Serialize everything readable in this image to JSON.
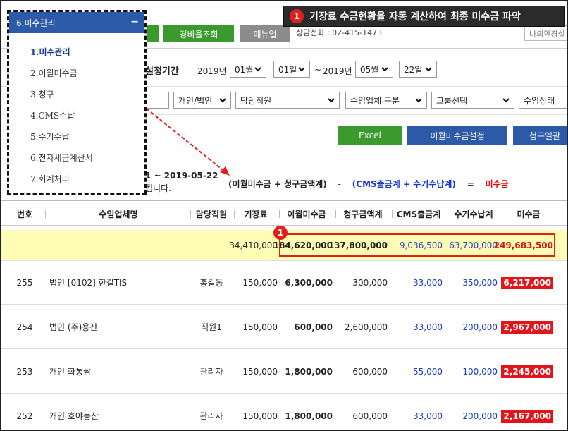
{
  "callout": {
    "badge": "1",
    "text": "기장료 수금현황을 자동 계산하여 최종 미수금 파악"
  },
  "topbar": {
    "btn_green2": "경비율조회",
    "btn_manual": "매뉴얼",
    "phone": "상담전화 : 02-415-1473",
    "right_box": "나의환경설"
  },
  "period": {
    "label": "설정기간",
    "start_year": "2019년",
    "start_month": "01월",
    "start_day": "01일",
    "tilde": "~",
    "end_year": "2019년",
    "end_month": "05월",
    "end_day": "22일"
  },
  "filters": {
    "type": "개인/법인",
    "manager": "담당직원",
    "company_type": "수임업체 구분",
    "group": "그룹선택",
    "status": "수임상태"
  },
  "actions": {
    "excel": "Excel",
    "carryover_setting": "이월미수금설정",
    "bill_batch": "청구일괄"
  },
  "summary": {
    "range": "1 ~ 2019-05-22",
    "range_sub": "됩니다.",
    "formula_a": "(이월미수금 + 청구금액계)",
    "op_minus": "-",
    "formula_b": "(CMS출금계 + 수기수납계)",
    "op_equal": "=",
    "formula_result": "미수금"
  },
  "menu": {
    "header": "6.미수관리",
    "collapse": "−",
    "items": [
      "1.미수관리",
      "2.이월미수금",
      "3.청구",
      "4.CMS수납",
      "5.수기수납",
      "6.전자세금계산서",
      "7.회계처리"
    ]
  },
  "table": {
    "headers": [
      "번호",
      "수임업체명",
      "담당직원",
      "기장료",
      "이월미수금",
      "청구금액계",
      "CMS출금계",
      "수기수납계",
      "미수금"
    ],
    "total": {
      "fee": "34,410,000",
      "carryover": "184,620,000",
      "billed": "137,800,000",
      "cms": "9,036,500",
      "manual": "63,700,000",
      "unpaid": "249,683,500",
      "badge": "1"
    },
    "rows": [
      {
        "no": "255",
        "name": "법인 [0102] 한길TIS",
        "manager": "홍길동",
        "fee": "150,000",
        "carryover": "6,300,000",
        "billed": "300,000",
        "cms": "33,000",
        "manual": "350,000",
        "unpaid": "6,217,000"
      },
      {
        "no": "254",
        "name": "법인 (주)용산",
        "manager": "직원1",
        "fee": "150,000",
        "carryover": "600,000",
        "billed": "2,600,000",
        "cms": "33,000",
        "manual": "200,000",
        "unpaid": "2,967,000"
      },
      {
        "no": "253",
        "name": "개인 화통쌈",
        "manager": "관리자",
        "fee": "150,000",
        "carryover": "1,800,000",
        "billed": "600,000",
        "cms": "55,000",
        "manual": "100,000",
        "unpaid": "2,245,000"
      },
      {
        "no": "252",
        "name": "개인 호야농산",
        "manager": "관리자",
        "fee": "150,000",
        "carryover": "1,800,000",
        "billed": "600,000",
        "cms": "33,000",
        "manual": "200,000",
        "unpaid": "2,167,000"
      }
    ]
  },
  "colors": {
    "green": "#3a9a2e",
    "blue": "#2d5aa8",
    "red": "#e0201a",
    "highlight": "#fffdb5"
  }
}
